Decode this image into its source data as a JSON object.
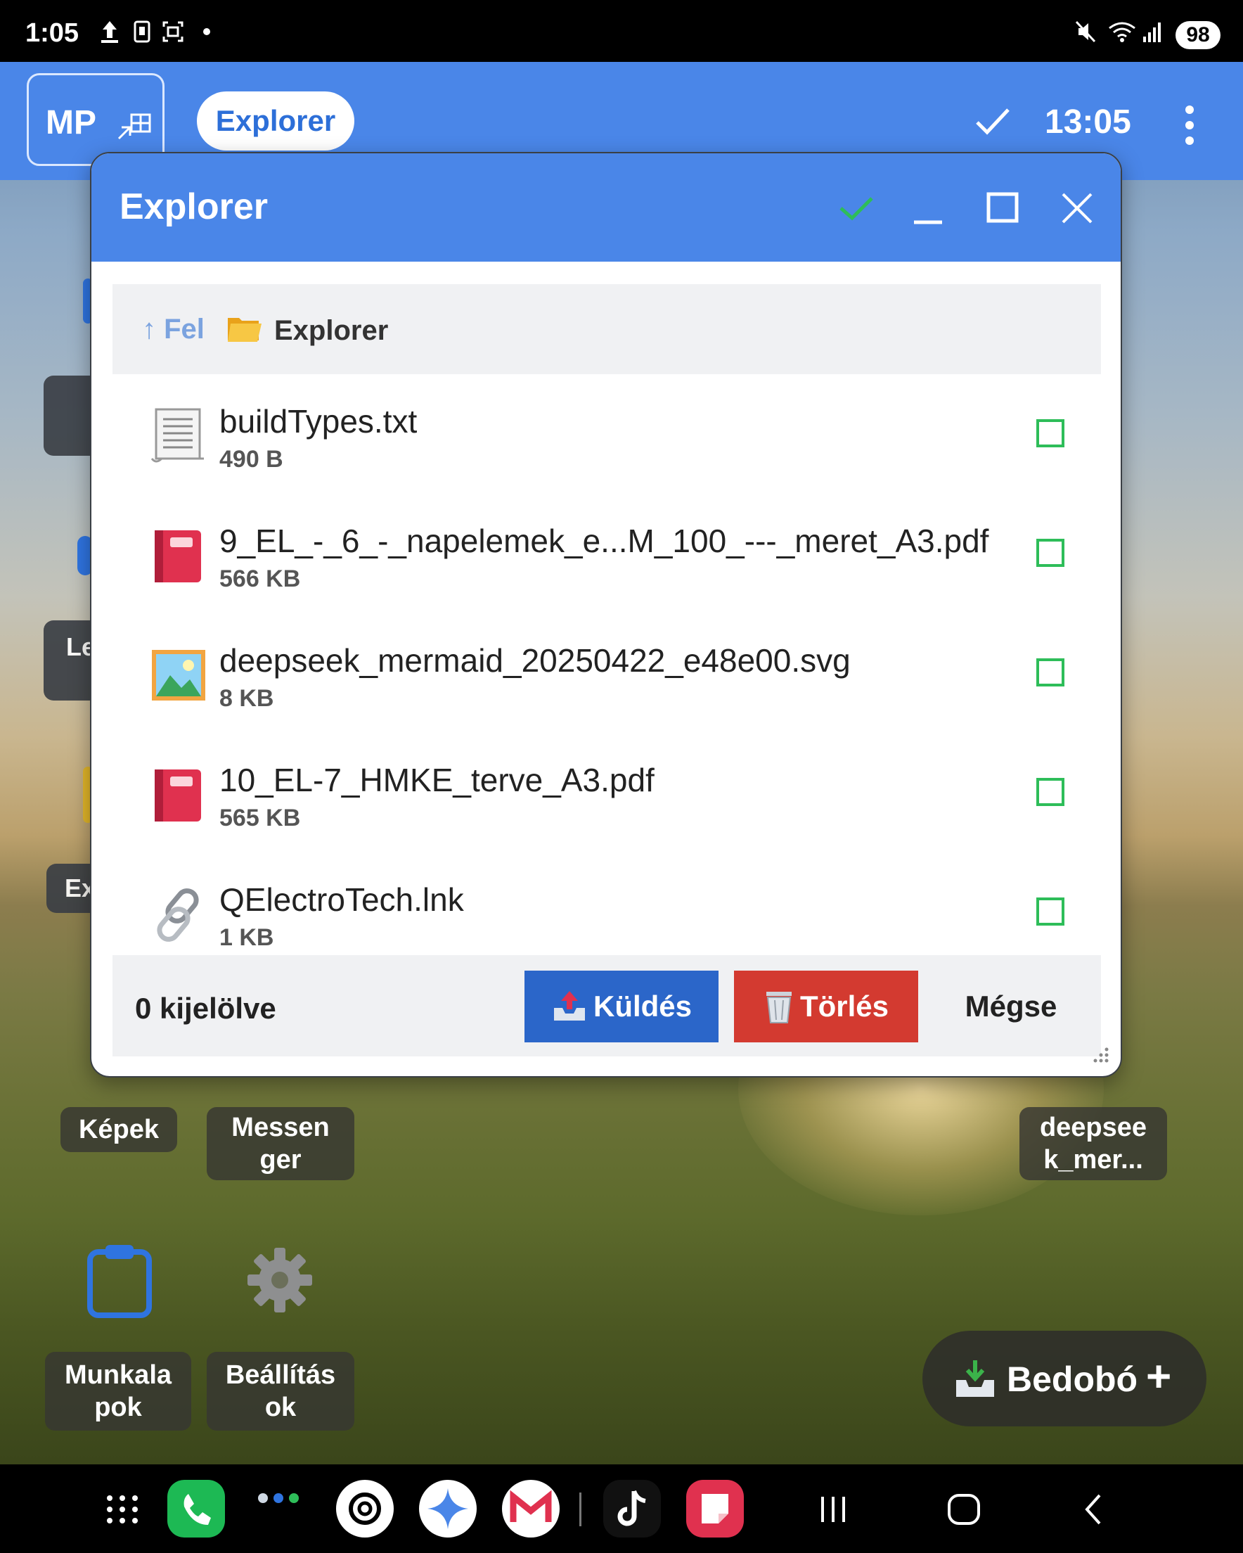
{
  "status_bar": {
    "time": "1:05",
    "battery": "98"
  },
  "top_bar": {
    "mp_label": "MP",
    "app_chip": "Explorer",
    "time": "13:05"
  },
  "window": {
    "title": "Explorer",
    "breadcrumb": {
      "up_label": "↑ Fel",
      "folder": "Explorer"
    },
    "files": [
      {
        "name": "buildTypes.txt",
        "size": "490 B",
        "icon": "text-file-icon"
      },
      {
        "name": "9_EL_-_6_-_napelemek_e...M_100_---_meret_A3.pdf",
        "size": "566 KB",
        "icon": "pdf-book-icon"
      },
      {
        "name": "deepseek_mermaid_20250422_e48e00.svg",
        "size": "8 KB",
        "icon": "image-file-icon"
      },
      {
        "name": "10_EL-7_HMKE_terve_A3.pdf",
        "size": "565 KB",
        "icon": "pdf-book-icon"
      },
      {
        "name": "QElectroTech.lnk",
        "size": "1 KB",
        "icon": "link-icon"
      }
    ],
    "selection_count": "0 kijelölve",
    "send_label": "Küldés",
    "delete_label": "Törlés",
    "cancel_label": "Mégse"
  },
  "desktop": {
    "partial_labels": [
      "Le",
      "Ex"
    ],
    "shortcuts": [
      {
        "label": "Képek"
      },
      {
        "label": "Messen ger"
      },
      {
        "label": "deepsee k_mer..."
      },
      {
        "label": "Munkala pok"
      },
      {
        "label": "Beállítás ok"
      }
    ],
    "drop_button": "Bedobó"
  },
  "colors": {
    "accent": "#4a86e8",
    "send": "#2b66c9",
    "delete": "#d33a30",
    "checkbox": "#2ebd59"
  }
}
